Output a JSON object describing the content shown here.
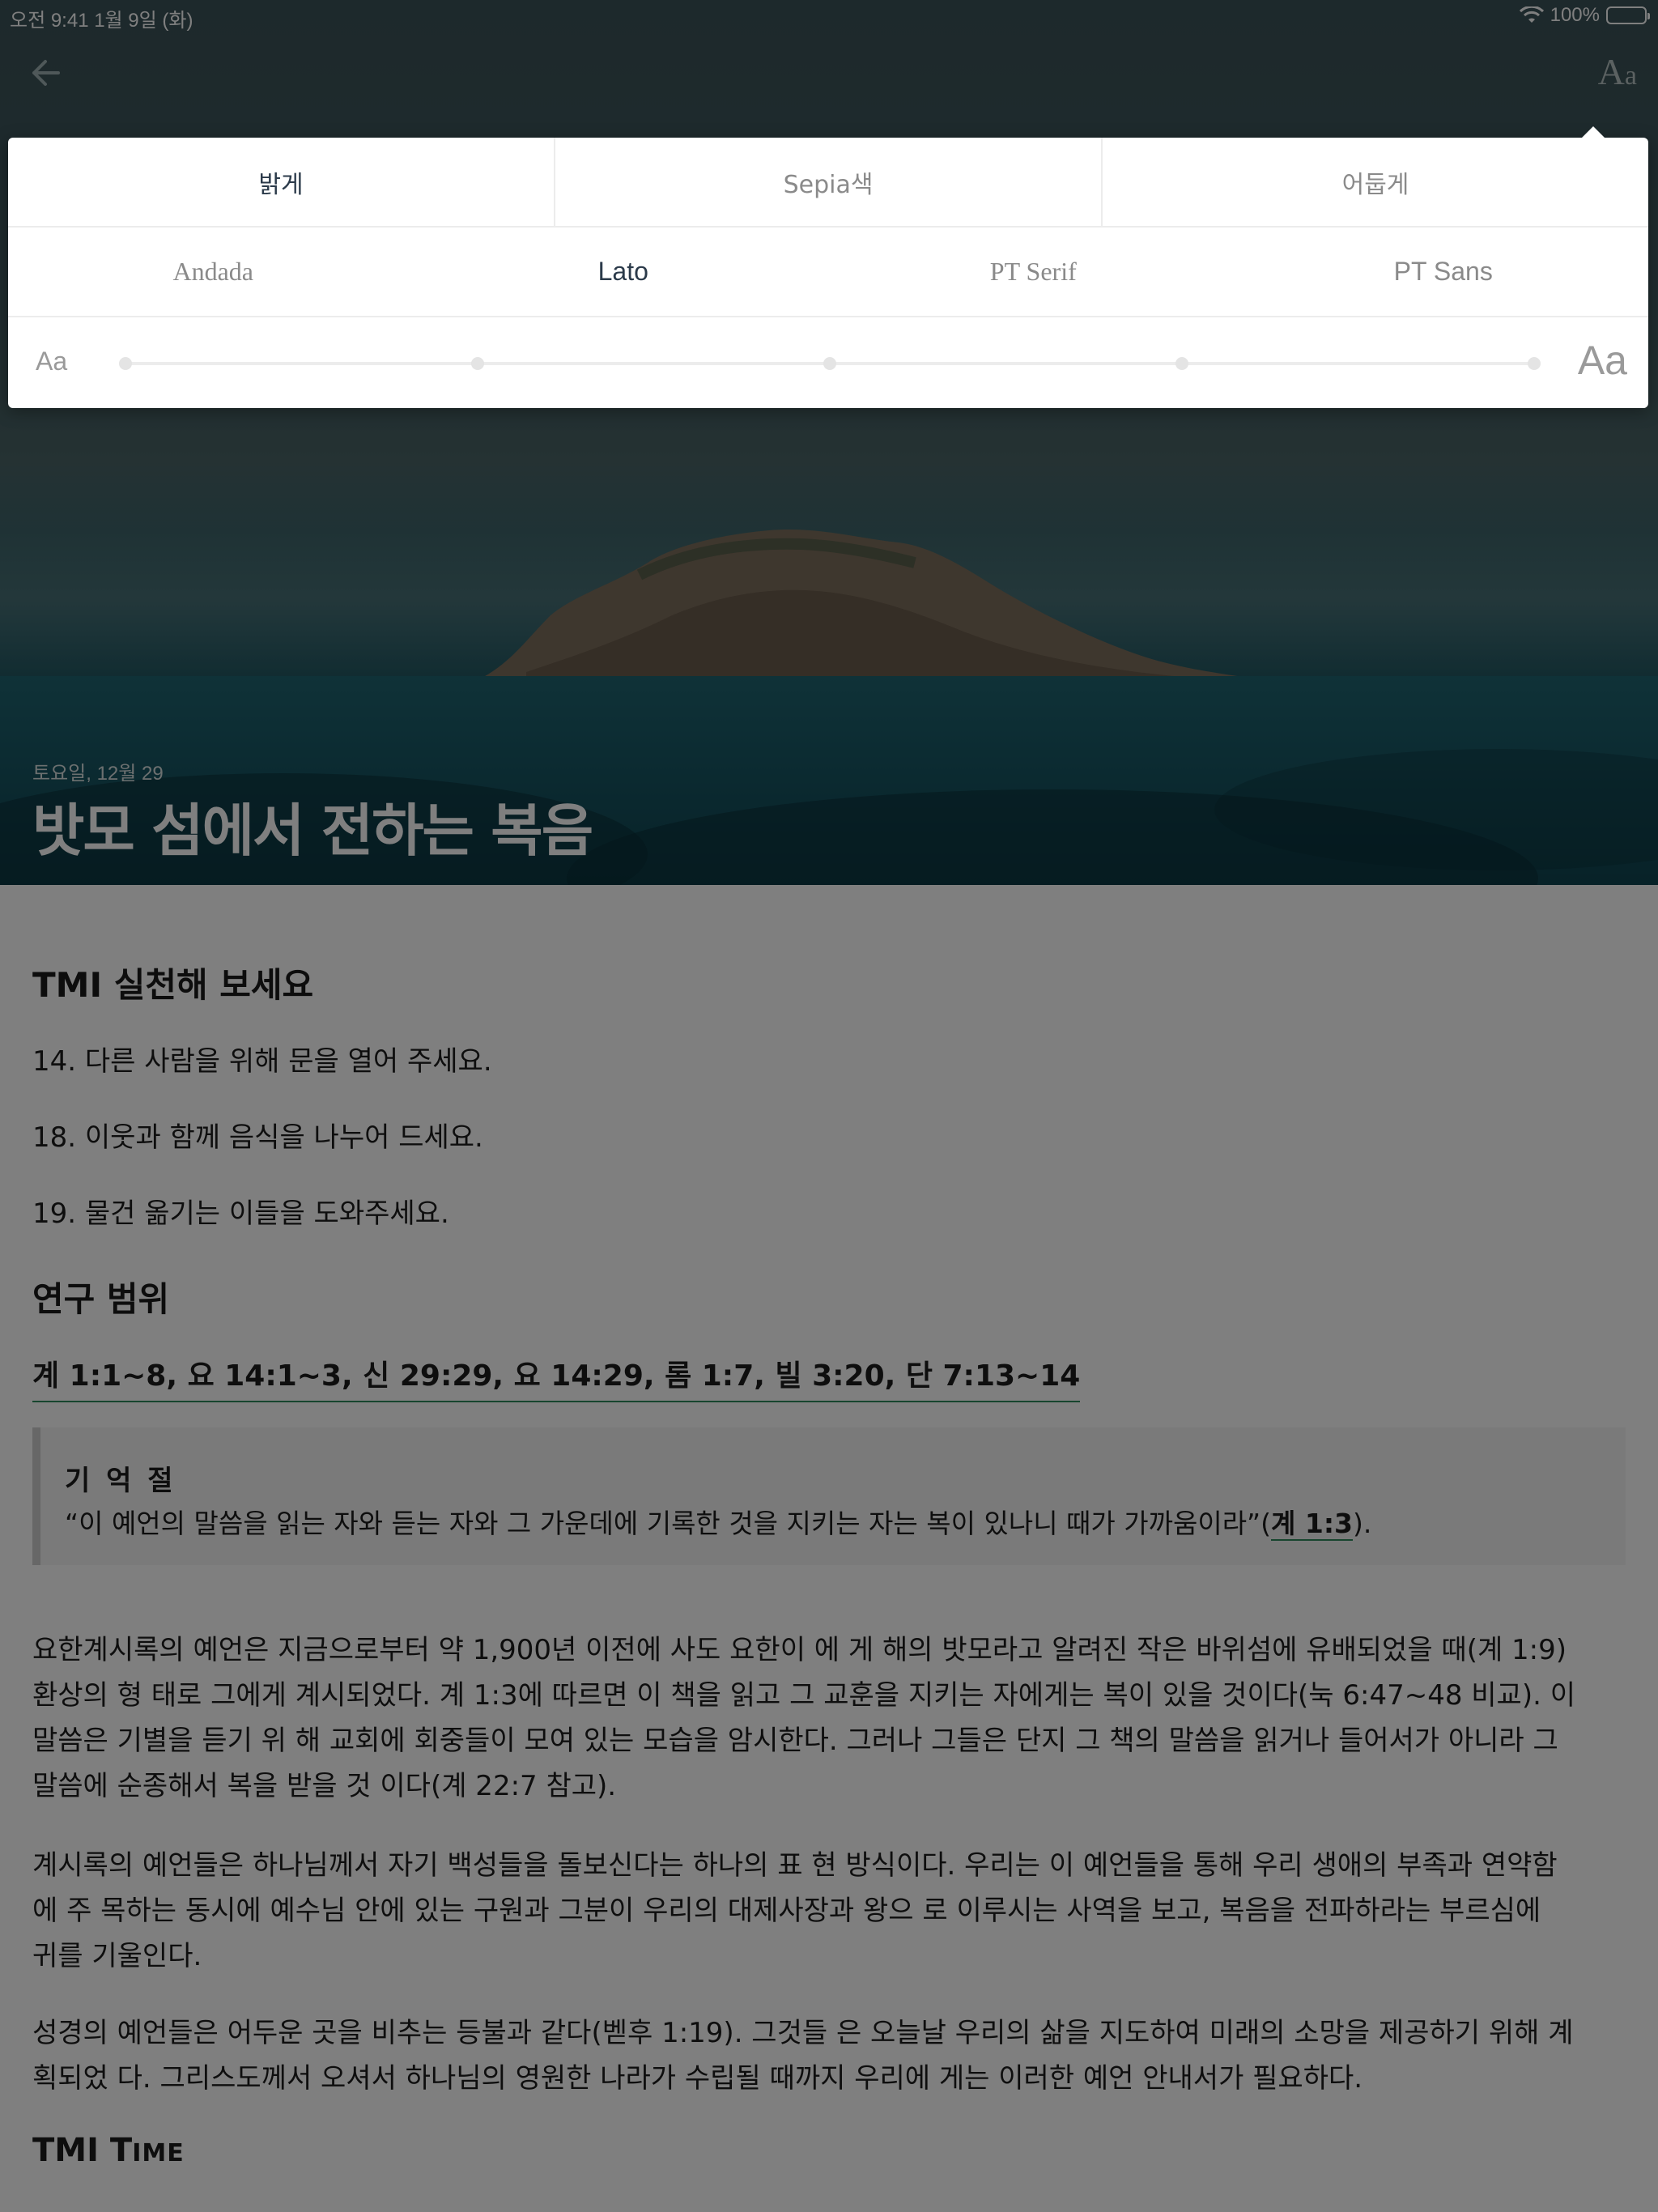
{
  "status": {
    "time_date": "오전 9:41   1월 9일 (화)",
    "battery": "100%"
  },
  "header": {
    "aa_label": "A",
    "aa_small": "a"
  },
  "hero": {
    "date": "토요일, 12월 29",
    "title": "밧모 섬에서 전하는 복음"
  },
  "settings": {
    "themes": [
      "밝게",
      "Sepia색",
      "어둡게"
    ],
    "active_theme": "밝게",
    "fonts": [
      "Andada",
      "Lato",
      "PT Serif",
      "PT Sans"
    ],
    "active_font": "Lato",
    "size_small_label": "Aa",
    "size_large_label": "Aa",
    "size_stops": 5,
    "size_level": 0.0
  },
  "article": {
    "practice_heading": "TMI 실천해 보세요",
    "practice_items": [
      "14. 다른 사람을 위해 문을 열어 주세요.",
      "18. 이웃과 함께 음식을 나누어 드세요.",
      "19. 물건 옮기는 이들을 도와주세요."
    ],
    "study_heading": "연구 범위",
    "study_refs": "계 1:1~8, 요 14:1~3, 신 29:29, 요 14:29, 롬 1:7, 빌 3:20, 단 7:13~14",
    "memory_title": "기 억 절",
    "memory_text": "“이 예언의 말씀을 읽는 자와 듣는 자와 그 가운데에 기록한 것을 지키는 자는 복이 있나니 때가 가까움이라”(",
    "memory_ref": "계 1:3",
    "memory_end": ").",
    "para1": [
      "요한계시록의 예언은 지금으로부터 약 1,900년 이전에 사도 요한이 에 게 해의 밧모라고 알려진 작은 바위섬에 유배되었을 때(계 1:9)",
      "환상의 형 태로 그에게 계시되었다. 계 1:3에 따르면 이 책을 읽고 그 교훈을 지키는 자에게는 복이 있을 것이다(눅 6:47~48 비교). 이",
      "말씀은 기별을 듣기 위 해 교회에 회중들이 모여 있는 모습을 암시한다. 그러나 그들은 단지 그 책의 말씀을 읽거나 들어서가 아니라 그",
      "말씀에 순종해서 복을 받을 것 이다(계 22:7 참고)."
    ],
    "para2": [
      "계시록의 예언들은 하나님께서 자기 백성들을 돌보신다는 하나의 표 현 방식이다. 우리는 이 예언들을 통해 우리 생애의 부족과 연약함",
      "에 주 목하는 동시에 예수님 안에 있는 구원과 그분이 우리의 대제사장과 왕으 로 이루시는 사역을 보고, 복음을 전파하라는 부르심에",
      "귀를 기울인다."
    ],
    "para3": [
      "성경의 예언들은 어두운 곳을 비추는 등불과 같다(벧후 1:19). 그것들 은 오늘날 우리의 삶을 지도하여 미래의 소망을 제공하기 위해 계",
      "획되었 다. 그리스도께서 오셔서 하나님의 영원한 나라가 수립될 때까지 우리에 게는 이러한 예언 안내서가 필요하다."
    ],
    "time_heading_a": "TMI T",
    "time_heading_b": "IME"
  }
}
